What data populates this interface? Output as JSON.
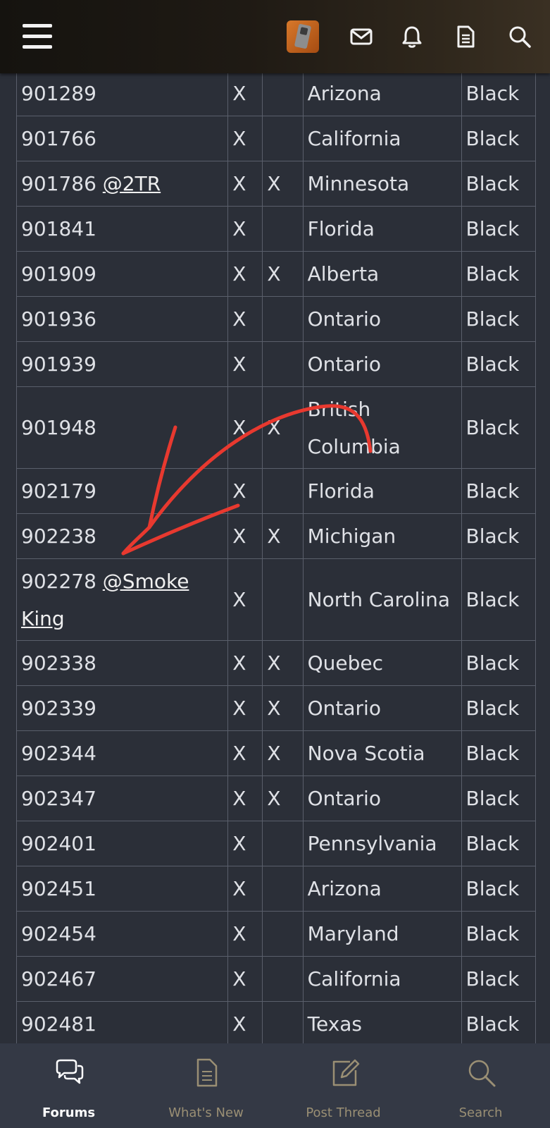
{
  "header": {
    "icons": [
      "menu-icon",
      "avatar",
      "mail-icon",
      "bell-icon",
      "document-icon",
      "search-icon"
    ]
  },
  "table": {
    "rows": [
      {
        "id": "901289",
        "mention": "",
        "x1": "X",
        "x2": "",
        "region": "Arizona",
        "color": "Black"
      },
      {
        "id": "901766",
        "mention": "",
        "x1": "X",
        "x2": "",
        "region": "California",
        "color": "Black"
      },
      {
        "id": "901786",
        "mention": "@2TR",
        "x1": "X",
        "x2": "X",
        "region": "Minnesota",
        "color": "Black"
      },
      {
        "id": "901841",
        "mention": "",
        "x1": "X",
        "x2": "",
        "region": "Florida",
        "color": "Black"
      },
      {
        "id": "901909",
        "mention": "",
        "x1": "X",
        "x2": "X",
        "region": "Alberta",
        "color": "Black"
      },
      {
        "id": "901936",
        "mention": "",
        "x1": "X",
        "x2": "",
        "region": "Ontario",
        "color": "Black"
      },
      {
        "id": "901939",
        "mention": "",
        "x1": "X",
        "x2": "",
        "region": "Ontario",
        "color": "Black"
      },
      {
        "id": "901948",
        "mention": "",
        "x1": "X",
        "x2": "X",
        "region": "British Columbia",
        "color": "Black"
      },
      {
        "id": "902179",
        "mention": "",
        "x1": "X",
        "x2": "",
        "region": "Florida",
        "color": "Black"
      },
      {
        "id": "902238",
        "mention": "",
        "x1": "X",
        "x2": "X",
        "region": "Michigan",
        "color": "Black"
      },
      {
        "id": "902278",
        "mention": "@Smoke King",
        "x1": "X",
        "x2": "",
        "region": "North Carolina",
        "color": "Black"
      },
      {
        "id": "902338",
        "mention": "",
        "x1": "X",
        "x2": "X",
        "region": "Quebec",
        "color": "Black"
      },
      {
        "id": "902339",
        "mention": "",
        "x1": "X",
        "x2": "X",
        "region": "Ontario",
        "color": "Black"
      },
      {
        "id": "902344",
        "mention": "",
        "x1": "X",
        "x2": "X",
        "region": "Nova Scotia",
        "color": "Black"
      },
      {
        "id": "902347",
        "mention": "",
        "x1": "X",
        "x2": "X",
        "region": "Ontario",
        "color": "Black"
      },
      {
        "id": "902401",
        "mention": "",
        "x1": "X",
        "x2": "",
        "region": "Pennsylvania",
        "color": "Black"
      },
      {
        "id": "902451",
        "mention": "",
        "x1": "X",
        "x2": "",
        "region": "Arizona",
        "color": "Black"
      },
      {
        "id": "902454",
        "mention": "",
        "x1": "X",
        "x2": "",
        "region": "Maryland",
        "color": "Black"
      },
      {
        "id": "902467",
        "mention": "",
        "x1": "X",
        "x2": "",
        "region": "California",
        "color": "Black"
      },
      {
        "id": "902481",
        "mention": "",
        "x1": "X",
        "x2": "",
        "region": "Texas",
        "color": "Black"
      }
    ]
  },
  "annotation": {
    "color": "#e8392f",
    "icon": "hand-drawn-arrow"
  },
  "bottom_nav": [
    {
      "label": "Forums",
      "icon": "chat-bubbles-icon",
      "active": true
    },
    {
      "label": "What's New",
      "icon": "document-icon",
      "active": false
    },
    {
      "label": "Post Thread",
      "icon": "compose-icon",
      "active": false
    },
    {
      "label": "Search",
      "icon": "search-icon",
      "active": false
    }
  ],
  "colors": {
    "background": "#2b2f38",
    "grid": "#5a5f6b",
    "nav_label": "#9a8f74",
    "nav_active": "#ffffff"
  }
}
